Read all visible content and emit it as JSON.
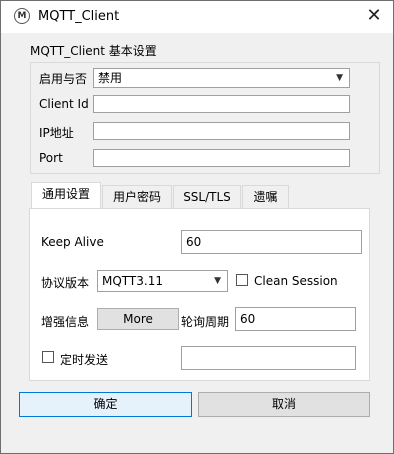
{
  "window": {
    "title": "MQTT_Client",
    "icon": "mqtt-app-icon",
    "close_glyph": "✕"
  },
  "settings": {
    "group_title": "MQTT_Client 基本设置",
    "enable_label": "启用与否",
    "enable_value": "禁用",
    "client_id_label": "Client Id",
    "client_id_value": "",
    "ip_label": "IP地址",
    "ip_value": "",
    "port_label": "Port",
    "port_value": ""
  },
  "tabs": [
    {
      "label": "通用设置",
      "active": true
    },
    {
      "label": "用户密码",
      "active": false
    },
    {
      "label": "SSL/TLS",
      "active": false
    },
    {
      "label": "遗嘱",
      "active": false
    }
  ],
  "general": {
    "keep_alive_label": "Keep Alive",
    "keep_alive_value": "60",
    "protocol_label": "协议版本",
    "protocol_value": "MQTT3.11",
    "clean_session_label": "Clean Session",
    "clean_session_checked": false,
    "enhanced_label": "增强信息",
    "more_button": "More",
    "poll_label": "轮询周期",
    "poll_value": "60",
    "timed_send_label": "定时发送",
    "timed_send_checked": false,
    "timed_send_value": ""
  },
  "footer": {
    "ok_label": "确定",
    "cancel_label": "取消"
  }
}
